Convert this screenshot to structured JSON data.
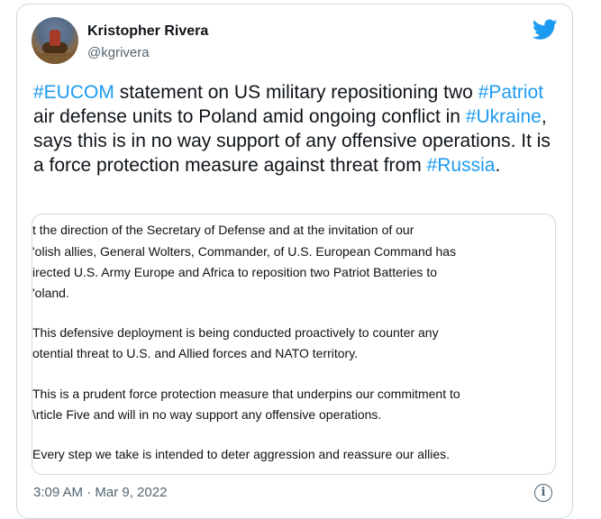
{
  "tweet": {
    "author_name": "Kristopher Rivera",
    "author_handle": "@kgrivera",
    "body": [
      {
        "t": "#EUCOM",
        "tag": true
      },
      {
        "t": " statement on US military repositioning two ",
        "tag": false
      },
      {
        "t": "#Patriot",
        "tag": true
      },
      {
        "t": " air defense units to Poland amid ongoing conflict in ",
        "tag": false
      },
      {
        "t": "#Ukraine",
        "tag": true
      },
      {
        "t": ", says this is in no way support of any offensive operations. It is a force protection measure against threat from ",
        "tag": false
      },
      {
        "t": "#Russia",
        "tag": true
      },
      {
        "t": ".",
        "tag": false
      }
    ],
    "timestamp": "3:09 AM · Mar 9, 2022",
    "info_icon": "info-icon",
    "brand_icon": "twitter-bird-icon",
    "colors": {
      "accent": "#1d9bf0",
      "text": "#0f1419",
      "muted": "#536471"
    }
  },
  "image_text": [
    "t the direction of the Secretary of Defense and at the invitation of our",
    "'olish allies, General Wolters, Commander, of U.S. European Command has",
    "irected U.S. Army Europe and Africa to reposition two Patriot Batteries to",
    "'oland.",
    "This defensive deployment is being conducted proactively to counter any",
    "otential threat to U.S. and Allied forces and NATO territory.",
    "This is a prudent force protection measure that underpins our commitment to",
    "\\rticle Five and will in no way support any offensive operations.",
    "Every step we take is intended to deter aggression and reassure our allies."
  ]
}
